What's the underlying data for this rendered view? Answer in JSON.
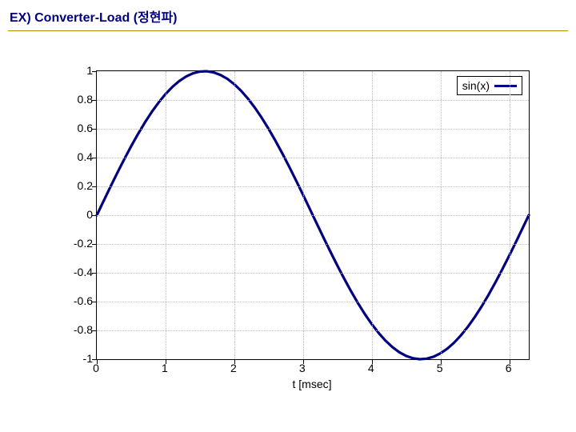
{
  "title": "EX)   Converter-Load  (정현파)",
  "chart_data": {
    "type": "line",
    "title": "",
    "xlabel": "t [msec]",
    "ylabel": "",
    "xlim": [
      0,
      6.283185307
    ],
    "ylim": [
      -1,
      1
    ],
    "x_ticks": [
      0,
      1,
      2,
      3,
      4,
      5,
      6
    ],
    "y_ticks": [
      -1,
      -0.8,
      -0.6,
      -0.4,
      -0.2,
      0,
      0.2,
      0.4,
      0.6,
      0.8,
      1
    ],
    "legend": {
      "position": "top-right"
    },
    "series": [
      {
        "name": "sin(x)",
        "color": "#000080",
        "x": [
          0,
          0.1,
          0.2,
          0.3,
          0.4,
          0.5,
          0.6,
          0.7,
          0.8,
          0.9,
          1,
          1.1,
          1.2,
          1.3,
          1.4,
          1.5,
          1.6,
          1.7,
          1.8,
          1.9,
          2,
          2.1,
          2.2,
          2.3,
          2.4,
          2.5,
          2.6,
          2.7,
          2.8,
          2.9,
          3,
          3.1,
          3.2,
          3.3,
          3.4,
          3.5,
          3.6,
          3.7,
          3.8,
          3.9,
          4,
          4.1,
          4.2,
          4.3,
          4.4,
          4.5,
          4.6,
          4.7,
          4.8,
          4.9,
          5,
          5.1,
          5.2,
          5.3,
          5.4,
          5.5,
          5.6,
          5.7,
          5.8,
          5.9,
          6,
          6.1,
          6.2,
          6.283185307
        ],
        "y": [
          0,
          0.0998,
          0.1987,
          0.2955,
          0.3894,
          0.4794,
          0.5646,
          0.6442,
          0.7174,
          0.7833,
          0.8415,
          0.8912,
          0.932,
          0.9636,
          0.9854,
          0.9975,
          0.9996,
          0.9917,
          0.9738,
          0.9463,
          0.9093,
          0.8632,
          0.8085,
          0.7457,
          0.6755,
          0.5985,
          0.5155,
          0.4274,
          0.335,
          0.2392,
          0.1411,
          0.0416,
          -0.0584,
          -0.1577,
          -0.2555,
          -0.3508,
          -0.4425,
          -0.5298,
          -0.6119,
          -0.6878,
          -0.7568,
          -0.8183,
          -0.8716,
          -0.9162,
          -0.9516,
          -0.9775,
          -0.9937,
          -0.9999,
          -0.9962,
          -0.9825,
          -0.9589,
          -0.9258,
          -0.8835,
          -0.8323,
          -0.7728,
          -0.7055,
          -0.6313,
          -0.5507,
          -0.4646,
          -0.3739,
          -0.2794,
          -0.1822,
          -0.0831,
          0
        ]
      }
    ]
  }
}
